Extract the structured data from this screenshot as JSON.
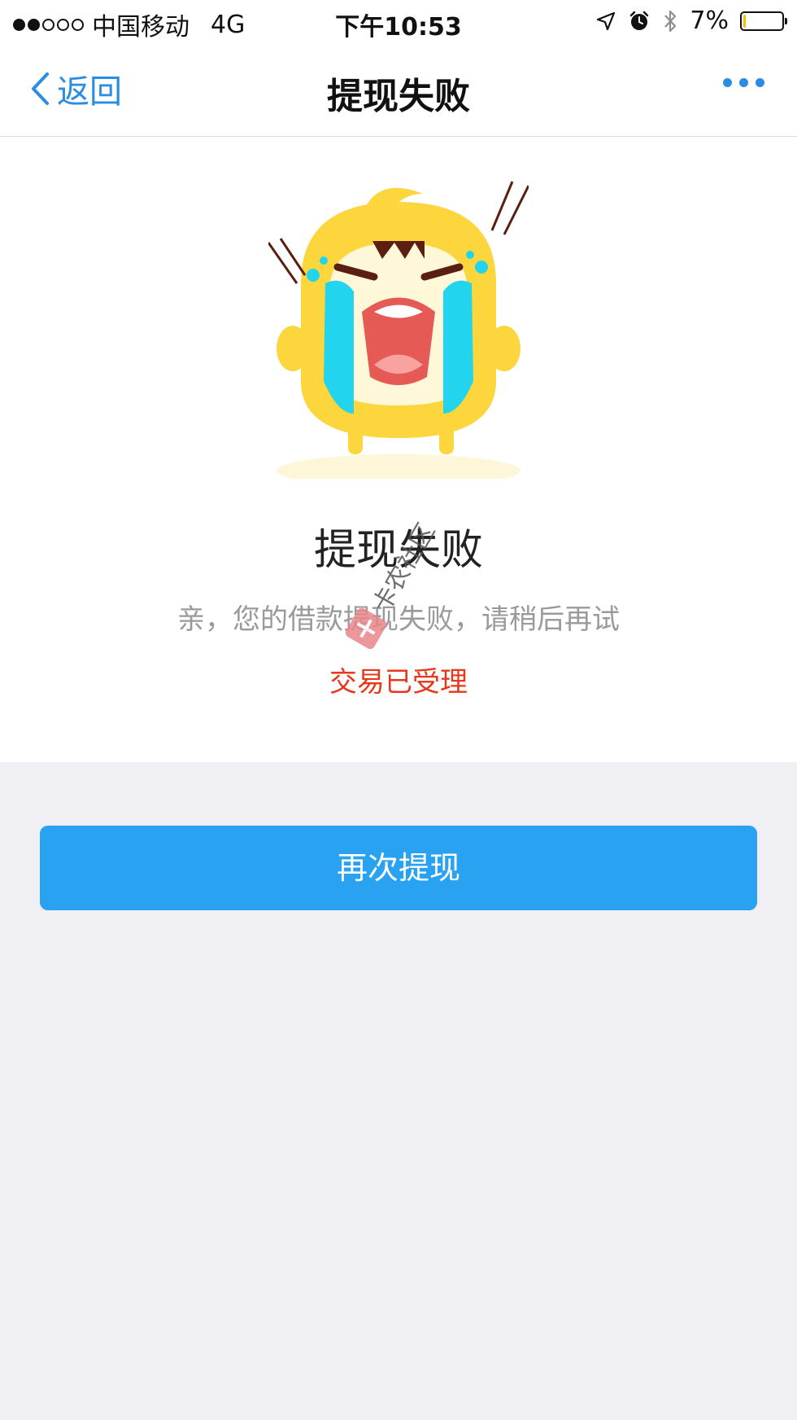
{
  "status_bar": {
    "carrier": "中国移动",
    "network": "4G",
    "time": "下午10:53",
    "battery": "7%",
    "battery_level": 0.07
  },
  "nav": {
    "back_label": "返回",
    "title": "提现失败"
  },
  "result": {
    "title": "提现失败",
    "description": "亲，您的借款提现失败，请稍后再试",
    "status": "交易已受理"
  },
  "watermark": {
    "text": "卡农社区"
  },
  "actions": {
    "retry_label": "再次提现"
  },
  "colors": {
    "accent": "#2a8de3",
    "button": "#29a2f2",
    "status_red": "#e5381c",
    "page_bg": "#efeff4"
  },
  "icons": {
    "signal": "signal-dots-icon",
    "location": "location-arrow-icon",
    "alarm": "alarm-clock-icon",
    "bluetooth": "bluetooth-icon",
    "battery": "battery-icon",
    "back": "chevron-left-icon",
    "more": "more-dots-icon",
    "mascot": "crying-mascot-icon",
    "watermark_logo": "watermark-logo-icon"
  }
}
